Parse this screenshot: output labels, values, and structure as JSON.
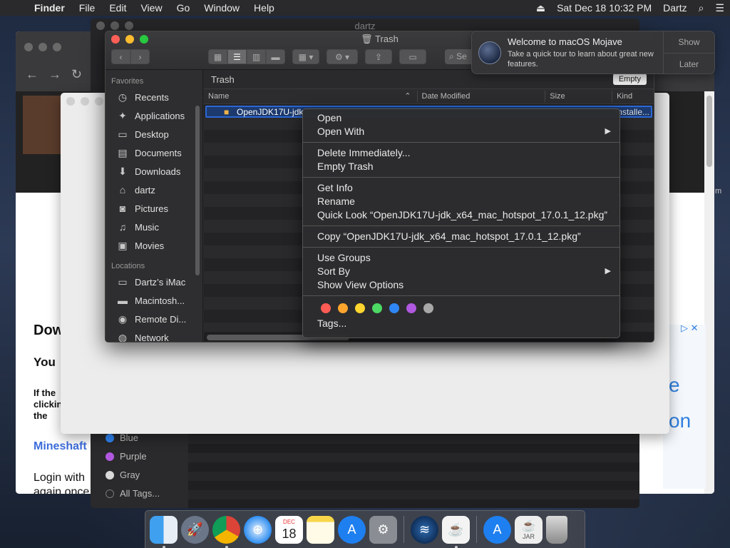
{
  "menubar": {
    "app": "Finder",
    "menus": [
      "File",
      "Edit",
      "View",
      "Go",
      "Window",
      "Help"
    ],
    "datetime": "Sat Dec 18  10:32 PM",
    "user": "Dartz"
  },
  "back_finder": {
    "title": "dartz",
    "tags": [
      {
        "label": "Blue",
        "color": "#2f86f6"
      },
      {
        "label": "Purple",
        "color": "#b058e0"
      },
      {
        "label": "Gray",
        "color": "#9a9a9a"
      }
    ],
    "all_tags": "All Tags..."
  },
  "web_page": {
    "heading": "Dow",
    "subheading": "You",
    "para": "If the clickin fix the",
    "link": "Mineshaft",
    "login": "Login with again once",
    "ad_text": "e on",
    "side_letter": "m"
  },
  "trash_window": {
    "title": "Trash",
    "path": "Trash",
    "empty_button": "Empty",
    "columns": [
      "Name",
      "Date Modified",
      "Size",
      "Kind"
    ],
    "file": {
      "name": "OpenJDK17U-jdk",
      "kind": "Installe..."
    },
    "search_placeholder": "Se"
  },
  "sidebar": {
    "favorites_label": "Favorites",
    "favorites": [
      {
        "label": "Recents",
        "icon": "clock-icon"
      },
      {
        "label": "Applications",
        "icon": "applications-icon"
      },
      {
        "label": "Desktop",
        "icon": "desktop-icon"
      },
      {
        "label": "Documents",
        "icon": "documents-icon"
      },
      {
        "label": "Downloads",
        "icon": "downloads-icon"
      },
      {
        "label": "dartz",
        "icon": "home-icon"
      },
      {
        "label": "Pictures",
        "icon": "camera-icon"
      },
      {
        "label": "Music",
        "icon": "music-icon"
      },
      {
        "label": "Movies",
        "icon": "film-icon"
      }
    ],
    "locations_label": "Locations",
    "locations": [
      {
        "label": "Dartz’s iMac",
        "icon": "imac-icon"
      },
      {
        "label": "Macintosh...",
        "icon": "disk-icon"
      },
      {
        "label": "Remote Di...",
        "icon": "remote-disc-icon"
      },
      {
        "label": "Network",
        "icon": "network-icon"
      }
    ]
  },
  "context_menu": {
    "open": "Open",
    "open_with": "Open With",
    "delete_immediately": "Delete Immediately...",
    "empty_trash": "Empty Trash",
    "get_info": "Get Info",
    "rename": "Rename",
    "quick_look": "Quick Look “OpenJDK17U-jdk_x64_mac_hotspot_17.0.1_12.pkg”",
    "copy": "Copy “OpenJDK17U-jdk_x64_mac_hotspot_17.0.1_12.pkg”",
    "use_groups": "Use Groups",
    "sort_by": "Sort By",
    "show_view_options": "Show View Options",
    "tags": "Tags...",
    "tag_colors": [
      "#ff5b55",
      "#ffa52d",
      "#ffd52e",
      "#4cd964",
      "#2f86f6",
      "#b058e0",
      "#a8a8a8"
    ]
  },
  "notification": {
    "title": "Welcome to macOS Mojave",
    "body": "Take a quick tour to learn about great new features.",
    "show": "Show",
    "later": "Later"
  },
  "dock": {
    "apps": [
      "finder-icon",
      "launchpad-icon",
      "chrome-icon",
      "safari-icon",
      "calendar-icon",
      "notes-icon",
      "app-store-icon",
      "system-preferences-icon",
      "migration-icon",
      "java-icon",
      "app-store-download-icon",
      "jar-file-icon",
      "trash-icon"
    ],
    "calendar_month": "DEC",
    "calendar_day": "18",
    "jar_label": "JAR"
  }
}
